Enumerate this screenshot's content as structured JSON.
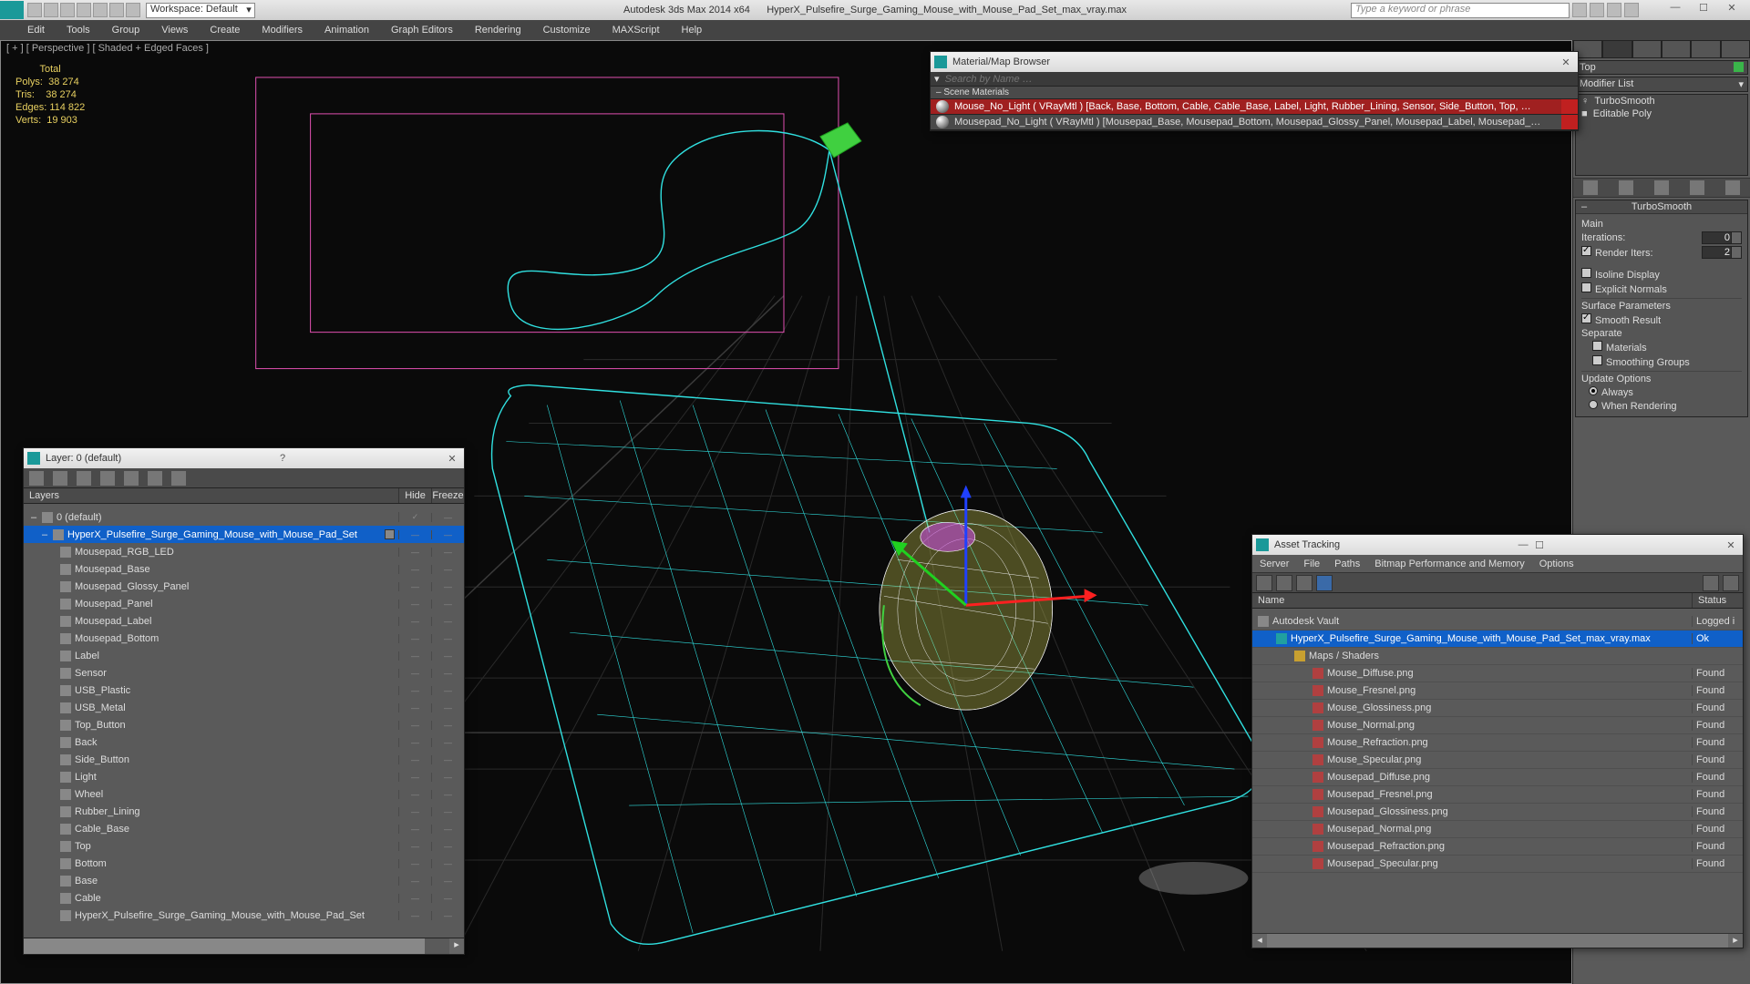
{
  "titlebar": {
    "workspace": "Workspace: Default",
    "app": "Autodesk 3ds Max  2014 x64",
    "file": "HyperX_Pulsefire_Surge_Gaming_Mouse_with_Mouse_Pad_Set_max_vray.max",
    "search_placeholder": "Type a keyword or phrase"
  },
  "menus": [
    "Edit",
    "Tools",
    "Group",
    "Views",
    "Create",
    "Modifiers",
    "Animation",
    "Graph Editors",
    "Rendering",
    "Customize",
    "MAXScript",
    "Help"
  ],
  "viewport": {
    "label": "[ + ] [ Perspective ] [ Shaded + Edged Faces ]",
    "stats": {
      "hdr": "Total",
      "polys_lbl": "Polys:",
      "polys": "38 274",
      "tris_lbl": "Tris:",
      "tris": "38 274",
      "edges_lbl": "Edges:",
      "edges": "114 822",
      "verts_lbl": "Verts:",
      "verts": "19 903"
    }
  },
  "mat": {
    "title": "Material/Map Browser",
    "search": "Search by Name …",
    "section": "– Scene Materials",
    "items": [
      "Mouse_No_Light ( VRayMtl ) [Back, Base, Bottom, Cable, Cable_Base, Label, Light, Rubber_Lining, Sensor, Side_Button, Top, …",
      "Mousepad_No_Light ( VRayMtl ) [Mousepad_Base, Mousepad_Bottom, Mousepad_Glossy_Panel, Mousepad_Label, Mousepad_…"
    ]
  },
  "layer": {
    "title": "Layer: 0 (default)",
    "cols": {
      "layers": "Layers",
      "hide": "Hide",
      "freeze": "Freeze"
    },
    "root": "0 (default)",
    "group": "HyperX_Pulsefire_Surge_Gaming_Mouse_with_Mouse_Pad_Set",
    "items": [
      "Mousepad_RGB_LED",
      "Mousepad_Base",
      "Mousepad_Glossy_Panel",
      "Mousepad_Panel",
      "Mousepad_Label",
      "Mousepad_Bottom",
      "Label",
      "Sensor",
      "USB_Plastic",
      "USB_Metal",
      "Top_Button",
      "Back",
      "Side_Button",
      "Light",
      "Wheel",
      "Rubber_Lining",
      "Cable_Base",
      "Top",
      "Bottom",
      "Base",
      "Cable",
      "HyperX_Pulsefire_Surge_Gaming_Mouse_with_Mouse_Pad_Set"
    ]
  },
  "cmd": {
    "top": "Top",
    "modlist": "Modifier List",
    "stack": [
      "TurboSmooth",
      "Editable Poly"
    ],
    "rollout": "TurboSmooth",
    "main": "Main",
    "iterations_lbl": "Iterations:",
    "iterations": "0",
    "render_iters_lbl": "Render Iters:",
    "render_iters": "2",
    "isoline": "Isoline Display",
    "explicit": "Explicit Normals",
    "surf": "Surface Parameters",
    "smooth": "Smooth Result",
    "separate": "Separate",
    "materials": "Materials",
    "smgroups": "Smoothing Groups",
    "update": "Update Options",
    "always": "Always",
    "whenrender": "When Rendering"
  },
  "asset": {
    "title": "Asset Tracking",
    "menus": [
      "Server",
      "File",
      "Paths",
      "Bitmap Performance and Memory",
      "Options"
    ],
    "cols": {
      "name": "Name",
      "status": "Status"
    },
    "rows": [
      {
        "pad": 6,
        "ico": "vault",
        "name": "Autodesk Vault",
        "status": "Logged i"
      },
      {
        "pad": 26,
        "ico": "max",
        "name": "HyperX_Pulsefire_Surge_Gaming_Mouse_with_Mouse_Pad_Set_max_vray.max",
        "status": "Ok",
        "sel": true
      },
      {
        "pad": 46,
        "ico": "fold",
        "name": "Maps / Shaders",
        "status": ""
      },
      {
        "pad": 66,
        "ico": "img",
        "name": "Mouse_Diffuse.png",
        "status": "Found"
      },
      {
        "pad": 66,
        "ico": "img",
        "name": "Mouse_Fresnel.png",
        "status": "Found"
      },
      {
        "pad": 66,
        "ico": "img",
        "name": "Mouse_Glossiness.png",
        "status": "Found"
      },
      {
        "pad": 66,
        "ico": "img",
        "name": "Mouse_Normal.png",
        "status": "Found"
      },
      {
        "pad": 66,
        "ico": "img",
        "name": "Mouse_Refraction.png",
        "status": "Found"
      },
      {
        "pad": 66,
        "ico": "img",
        "name": "Mouse_Specular.png",
        "status": "Found"
      },
      {
        "pad": 66,
        "ico": "img",
        "name": "Mousepad_Diffuse.png",
        "status": "Found"
      },
      {
        "pad": 66,
        "ico": "img",
        "name": "Mousepad_Fresnel.png",
        "status": "Found"
      },
      {
        "pad": 66,
        "ico": "img",
        "name": "Mousepad_Glossiness.png",
        "status": "Found"
      },
      {
        "pad": 66,
        "ico": "img",
        "name": "Mousepad_Normal.png",
        "status": "Found"
      },
      {
        "pad": 66,
        "ico": "img",
        "name": "Mousepad_Refraction.png",
        "status": "Found"
      },
      {
        "pad": 66,
        "ico": "img",
        "name": "Mousepad_Specular.png",
        "status": "Found"
      }
    ]
  }
}
